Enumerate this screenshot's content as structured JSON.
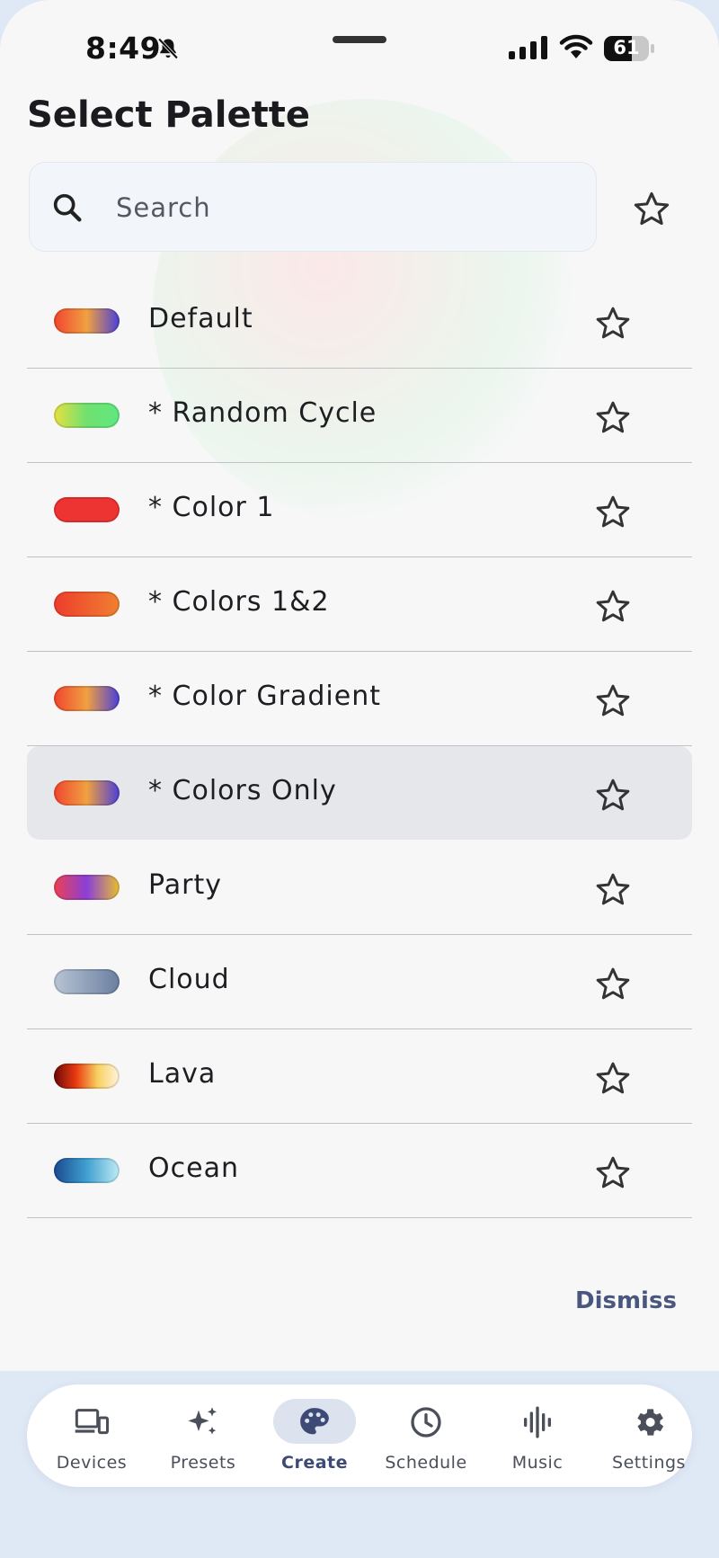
{
  "status": {
    "time": "8:49",
    "battery": "61",
    "battery_fraction": 0.61
  },
  "title": "Select Palette",
  "search": {
    "placeholder": "Search"
  },
  "palettes": [
    {
      "label": "Default",
      "gradient": [
        "#f0442e",
        "#f0a040",
        "#4a3fd8"
      ]
    },
    {
      "label": "* Random Cycle",
      "gradient": [
        "#e8e040",
        "#70e070",
        "#60e880"
      ]
    },
    {
      "label": "* Color 1",
      "gradient": [
        "#ee3333",
        "#ee3333"
      ]
    },
    {
      "label": "* Colors 1&2",
      "gradient": [
        "#ee3c2e",
        "#f08030"
      ]
    },
    {
      "label": "* Color Gradient",
      "gradient": [
        "#f0442e",
        "#f0a040",
        "#4a3fd8"
      ]
    },
    {
      "label": "* Colors Only",
      "gradient": [
        "#f0442e",
        "#f0a040",
        "#4a3fd8"
      ]
    },
    {
      "label": "Party",
      "gradient": [
        "#ee4050",
        "#8a3fd8",
        "#e8c030"
      ]
    },
    {
      "label": "Cloud",
      "gradient": [
        "#b8c4d4",
        "#6a7fa0"
      ]
    },
    {
      "label": "Lava",
      "gradient": [
        "#6a0808",
        "#e83a10",
        "#f8d060",
        "#fff4e0"
      ]
    },
    {
      "label": "Ocean",
      "gradient": [
        "#1a4a90",
        "#40a0d0",
        "#c0ecf4"
      ]
    }
  ],
  "selected_index": 5,
  "dismiss_label": "Dismiss",
  "nav": [
    {
      "label": "Devices",
      "icon": "devices-icon"
    },
    {
      "label": "Presets",
      "icon": "sparkle-icon"
    },
    {
      "label": "Create",
      "icon": "palette-icon",
      "active": true
    },
    {
      "label": "Schedule",
      "icon": "clock-icon"
    },
    {
      "label": "Music",
      "icon": "waveform-icon"
    },
    {
      "label": "Settings",
      "icon": "gear-icon"
    }
  ],
  "colors": {
    "accent": "#49577f",
    "selected_row": "#e6e7eb",
    "nav_active_pill": "#dde3ee"
  }
}
